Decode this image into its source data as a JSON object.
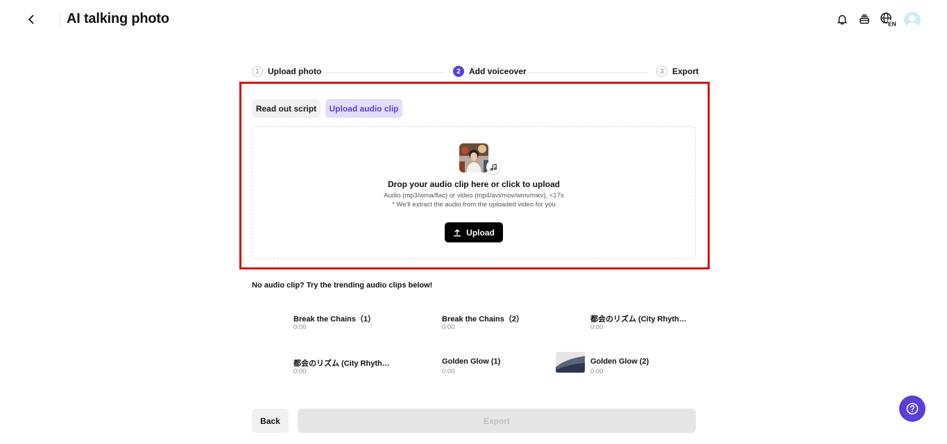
{
  "header": {
    "title": "AI talking photo",
    "icons": [
      "back-arrow-icon",
      "bell-icon",
      "layers-icon",
      "globe-icon",
      "avatar"
    ],
    "language_badge": "EN"
  },
  "steps": [
    {
      "number": "1",
      "label": "Upload photo",
      "state": "done"
    },
    {
      "number": "2",
      "label": "Add voiceover",
      "state": "active"
    },
    {
      "number": "3",
      "label": "Export",
      "state": "pending"
    }
  ],
  "tabs": {
    "read_script": "Read out script",
    "upload_audio": "Upload audio clip",
    "selected": "upload_audio"
  },
  "dropzone": {
    "title": "Drop your audio clip here or click to upload",
    "formats": "Audio (mp3/wma/flac) or video (mp4/avi/mov/wmv/mkv), <17s",
    "note": "* We'll extract the audio from the uploaded video for you",
    "upload_label": "Upload"
  },
  "trending": {
    "heading": "No audio clip? Try the trending audio clips below!",
    "clips": [
      {
        "title": "Break the Chains（1）",
        "duration": "0:00"
      },
      {
        "title": "Break the Chains（2）",
        "duration": "0:00"
      },
      {
        "title": "都会のリズム (City Rhythm...",
        "duration": "0:00"
      },
      {
        "title": "都会のリズム (City Rhythm...",
        "duration": "0:00"
      },
      {
        "title": "Golden Glow (1)",
        "duration": "0:00"
      },
      {
        "title": "Golden Glow (2)",
        "duration": "0:00"
      }
    ]
  },
  "footer": {
    "back_label": "Back",
    "export_label": "Export",
    "export_enabled": false
  },
  "colors": {
    "accent": "#5b3fd9",
    "tab_selected_bg": "#e4dcfb",
    "highlight_border": "#d01414"
  }
}
